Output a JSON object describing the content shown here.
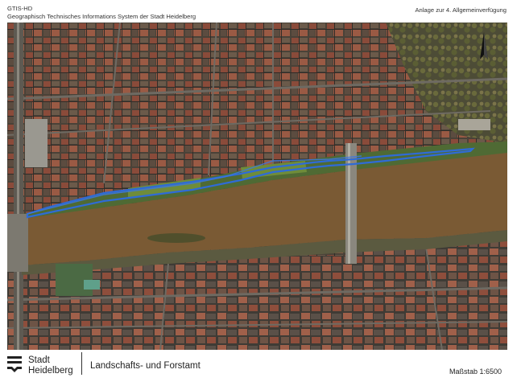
{
  "header": {
    "system_short": "GTIS-HD",
    "system_full": "Geographisch Technisches Informations System der Stadt Heidelberg",
    "attachment": "Anlage zur 4. Allgemeinverfügung"
  },
  "map": {
    "north_arrow_icon": "north-arrow-icon",
    "river_color": "#7a5a34",
    "boundary_color": "#2f6bd6"
  },
  "footer": {
    "logo_line1": "Stadt",
    "logo_line2": "Heidelberg",
    "department": "Landschafts- und Forstamt",
    "scale": "Maßstab 1:6500"
  }
}
